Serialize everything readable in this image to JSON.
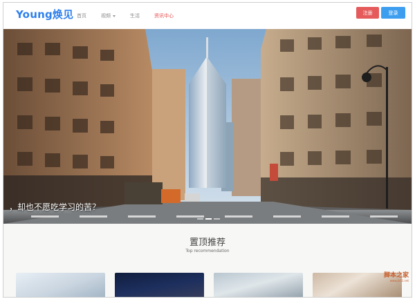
{
  "header": {
    "logo_text": "Young焕见",
    "nav": [
      {
        "label": "首页",
        "dropdown": false,
        "active": false
      },
      {
        "label": "视频",
        "dropdown": true,
        "active": false
      },
      {
        "label": "生活",
        "dropdown": false,
        "active": false
      },
      {
        "label": "资讯中心",
        "dropdown": false,
        "active": true
      }
    ],
    "register_label": "注册",
    "login_label": "登录"
  },
  "hero": {
    "caption": "，却也不愿吃学习的苦？",
    "slide_count": 3,
    "active_slide": 1
  },
  "recommend": {
    "title": "置顶推荐",
    "subtitle": "Top recommendation"
  },
  "watermark": {
    "main": "脚本之家",
    "sub": "www.jb51.net"
  },
  "colors": {
    "logo": "#2f80ed",
    "nav_active": "#e84a4a",
    "register": "#e55b5b",
    "login": "#3d9ef0"
  }
}
